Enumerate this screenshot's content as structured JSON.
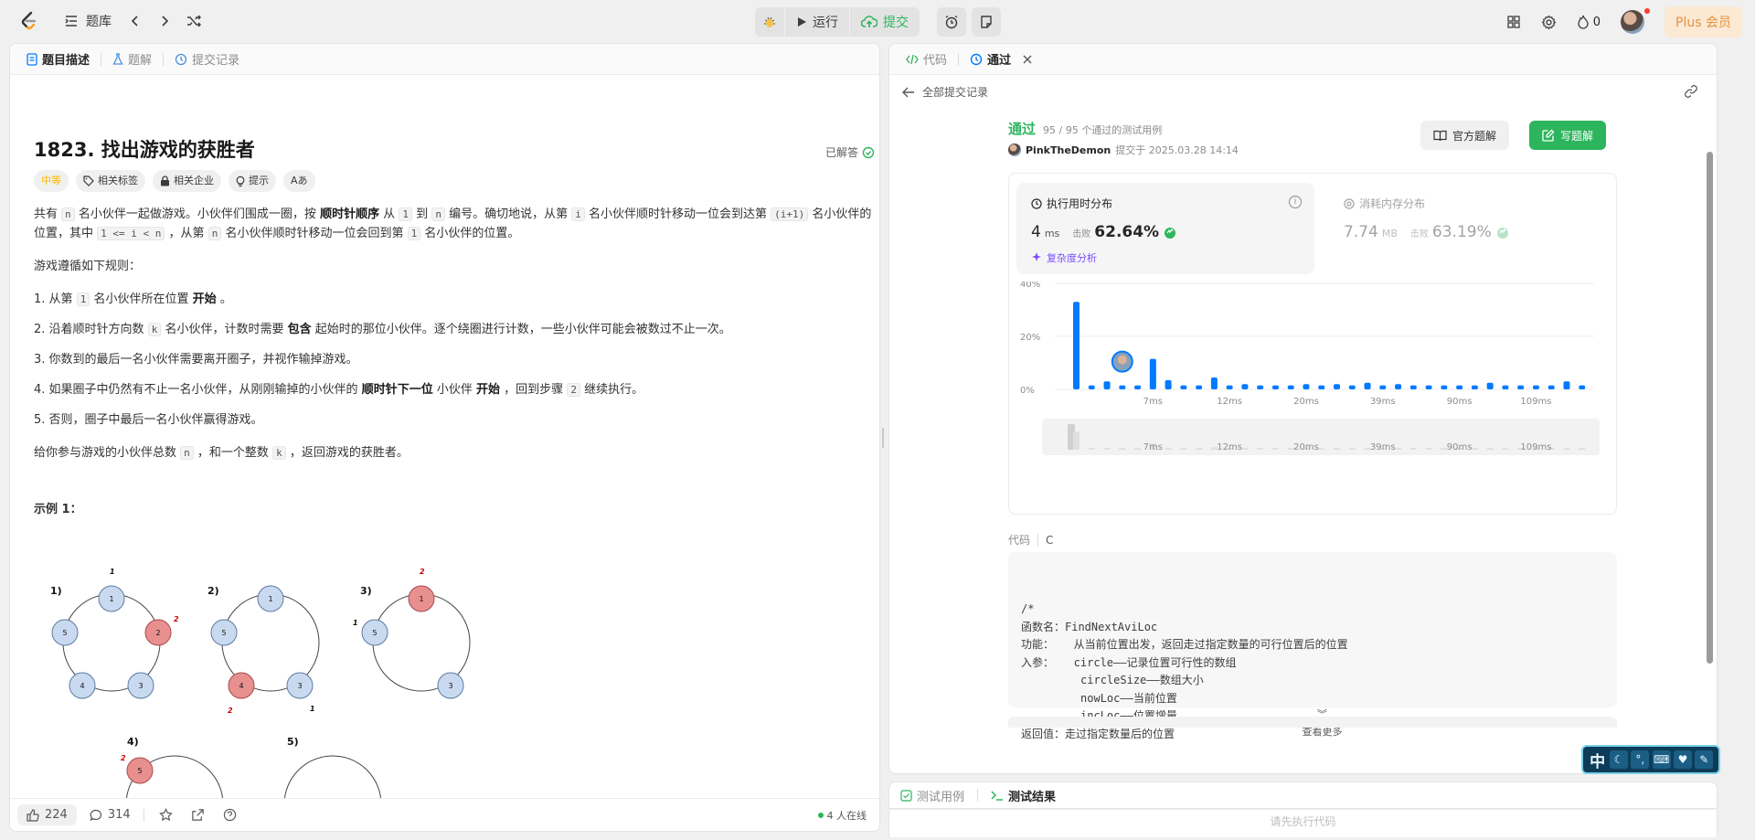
{
  "topbar": {
    "problem_bank_label": "题库",
    "run_label": "运行",
    "submit_label": "提交",
    "streak_count": "0",
    "plus_label": "Plus 会员"
  },
  "left_panel": {
    "tabs": [
      {
        "label": "题目描述"
      },
      {
        "label": "题解"
      },
      {
        "label": "提交记录"
      }
    ],
    "title": "1823. 找出游戏的获胜者",
    "solved_label": "已解答",
    "chips": {
      "difficulty": "中等",
      "tags": "相关标签",
      "companies": "相关企业",
      "hint": "提示",
      "translate": "Aあ"
    },
    "desc": {
      "p1_a": "共有",
      "p1_n": "n",
      "p1_b": "名小伙伴一起做游戏。小伙伴们围成一圈，按",
      "p1_bold": "顺时针顺序",
      "p1_c": "从",
      "p1_one": "1",
      "p1_d": "到",
      "p1_n2": "n",
      "p1_e": "编号。确切地说，从第",
      "p1_i": "i",
      "p1_f": "名小伙伴顺时针移动一位会到达第",
      "p1_i1": "(i+1)",
      "p1_g": "名小伙伴的位置，其中",
      "p1_range": "1 <= i < n",
      "p1_h": "，从第",
      "p1_n3": "n",
      "p1_j": "名小伙伴顺时针移动一位会回到第",
      "p1_one2": "1",
      "p1_k": "名小伙伴的位置。",
      "rules_intro": "游戏遵循如下规则：",
      "r1_a": "1. 从第",
      "r1_one": "1",
      "r1_b": "名小伙伴所在位置",
      "r1_bold": "开始",
      "r1_c": "。",
      "r2_a": "2. 沿着顺时针方向数",
      "r2_k": "k",
      "r2_b": "名小伙伴，计数时需要",
      "r2_bold": "包含",
      "r2_c": "起始时的那位小伙伴。逐个绕圈进行计数，一些小伙伴可能会被数过不止一次。",
      "r3": "3. 你数到的最后一名小伙伴需要离开圈子，并视作输掉游戏。",
      "r4_a": "4. 如果圈子中仍然有不止一名小伙伴，从刚刚输掉的小伙伴的",
      "r4_bold1": "顺时针下一位",
      "r4_b": "小伙伴",
      "r4_bold2": "开始",
      "r4_c": "，回到步骤",
      "r4_two": "2",
      "r4_d": "继续执行。",
      "r5": "5. 否则，圈子中最后一名小伙伴赢得游戏。",
      "q_a": "给你参与游戏的小伙伴总数",
      "q_n": "n",
      "q_b": "，和一个整数",
      "q_k": "k",
      "q_c": "，返回游戏的获胜者。",
      "example_title": "示例 1："
    },
    "figure_labels": {
      "s1": "1)",
      "s2": "2)",
      "s3": "3)",
      "s4": "4)",
      "s5": "5)",
      "n1": "1",
      "n2": "2",
      "n3": "3",
      "n4": "4",
      "n5": "5"
    },
    "footer": {
      "likes": "224",
      "comments": "314",
      "online": "4 人在线"
    }
  },
  "right_panel": {
    "tabs": [
      {
        "label": "代码"
      },
      {
        "label": "通过"
      }
    ],
    "back_label": "全部提交记录",
    "status": "通过",
    "status_detail": "95 / 95 个通过的测试用例",
    "user": "PinkTheDemon",
    "submitted_at": "提交于 2025.03.28 14:14",
    "official_btn": "官方题解",
    "write_btn": "写题解",
    "runtime": {
      "title": "执行用时分布",
      "value": "4",
      "unit": "ms",
      "beats_label": "击败",
      "beats": "62.64%",
      "complexity": "复杂度分析"
    },
    "memory": {
      "title": "消耗内存分布",
      "value": "7.74",
      "unit": "MB",
      "beats_label": "击败",
      "beats": "63.19%"
    },
    "code_label": "代码",
    "code_lang": "C",
    "code_lines": [
      "/*",
      "函数名：FindNextAviLoc",
      "功能：   从当前位置出发，返回走过指定数量的可行位置后的位置",
      "入参：   circle——记录位置可行性的数组",
      "         circleSize——数组大小",
      "         nowLoc——当前位置",
      "         incLoc——位置增量",
      "返回值：走过指定数量后的位置"
    ],
    "view_more": "查看更多"
  },
  "test_panel": {
    "tab_cases": "测试用例",
    "tab_result": "测试结果",
    "hint": "请先执行代码"
  },
  "ime": {
    "mode": "中"
  },
  "chart_data": {
    "type": "bar",
    "title": "执行用时分布",
    "ylim": [
      0,
      40
    ],
    "yticks": [
      "0%",
      "20%",
      "40%"
    ],
    "xticks": [
      "7ms",
      "12ms",
      "20ms",
      "39ms",
      "90ms",
      "109ms"
    ],
    "values": [
      33,
      1.5,
      3,
      1.5,
      1.5,
      11.5,
      3.5,
      1.5,
      1.5,
      4.5,
      1.5,
      2,
      1.5,
      1.5,
      1.5,
      2,
      1.5,
      2,
      1.5,
      2.5,
      1.5,
      2,
      1.5,
      1.5,
      1.5,
      1.5,
      1.5,
      2.5,
      1.5,
      1.5,
      1.5,
      1.5,
      3,
      1.5
    ],
    "highlight_index": 3,
    "colors": {
      "bar": "#007aff",
      "grid": "#eeeeee",
      "accent": "#2db55d"
    }
  }
}
